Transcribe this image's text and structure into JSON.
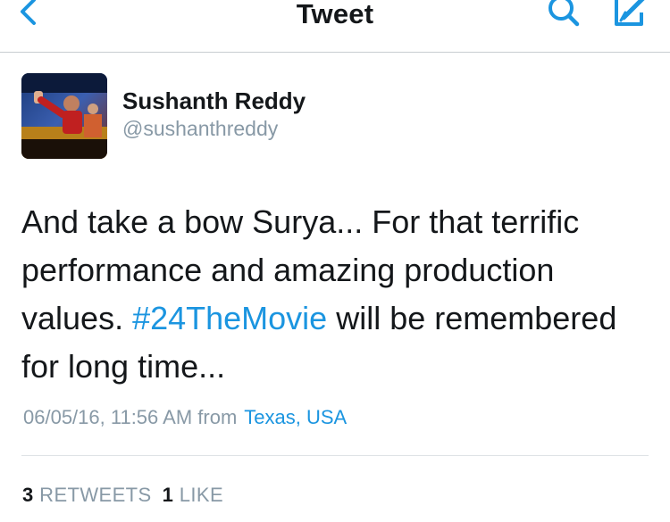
{
  "nav": {
    "title": "Tweet",
    "back_icon": "chevron-left-icon",
    "search_icon": "search-icon",
    "compose_icon": "compose-icon",
    "accent_color": "#1b95e0"
  },
  "author": {
    "display_name": "Sushanth Reddy",
    "handle": "@sushanthreddy",
    "avatar": "avatar-photo"
  },
  "tweet": {
    "line1": "And take a bow Surya... For that terrific",
    "line2": "performance and amazing production",
    "line3_pre": "values. ",
    "hashtag": "#24TheMovie",
    "line3_post": " will be remembered",
    "line4": "for long time..."
  },
  "meta": {
    "timestamp": "06/05/16, 11:56 AM from",
    "location": "Texas, USA"
  },
  "stats": {
    "retweets_count": "3",
    "retweets_label": "RETWEETS",
    "likes_count": "1",
    "likes_label": "LIKE"
  }
}
